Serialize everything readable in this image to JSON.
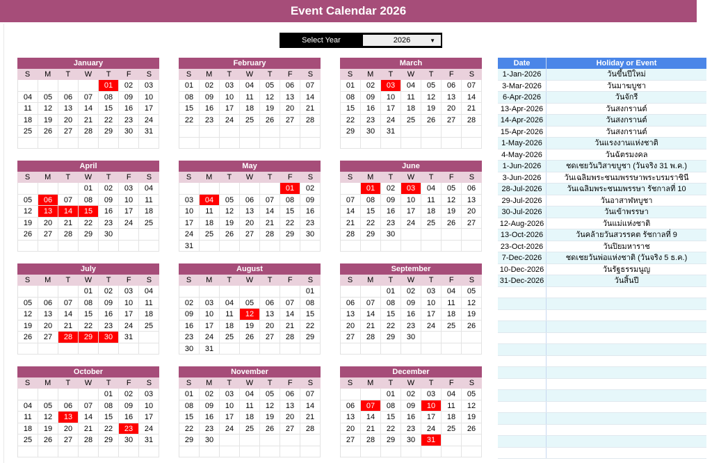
{
  "title": "Event Calendar 2026",
  "year_selector": {
    "label": "Select Year",
    "value": "2026"
  },
  "day_headers": [
    "S",
    "M",
    "T",
    "W",
    "T",
    "F",
    "S"
  ],
  "months": [
    {
      "name": "January",
      "start": 4,
      "days": 31,
      "holidays": [
        1
      ]
    },
    {
      "name": "February",
      "start": 0,
      "days": 28,
      "holidays": []
    },
    {
      "name": "March",
      "start": 0,
      "days": 31,
      "holidays": [
        3
      ]
    },
    {
      "name": "April",
      "start": 3,
      "days": 30,
      "holidays": [
        6,
        13,
        14,
        15
      ]
    },
    {
      "name": "May",
      "start": 5,
      "days": 31,
      "holidays": [
        1,
        4
      ]
    },
    {
      "name": "June",
      "start": 1,
      "days": 30,
      "holidays": [
        1,
        3
      ]
    },
    {
      "name": "July",
      "start": 3,
      "days": 31,
      "holidays": [
        28,
        29,
        30
      ]
    },
    {
      "name": "August",
      "start": 6,
      "days": 31,
      "holidays": [
        12
      ]
    },
    {
      "name": "September",
      "start": 2,
      "days": 30,
      "holidays": []
    },
    {
      "name": "October",
      "start": 4,
      "days": 31,
      "holidays": [
        13,
        23
      ]
    },
    {
      "name": "November",
      "start": 0,
      "days": 30,
      "holidays": []
    },
    {
      "name": "December",
      "start": 2,
      "days": 31,
      "holidays": [
        7,
        10,
        31
      ]
    }
  ],
  "events": {
    "headers": {
      "date": "Date",
      "event": "Holiday or Event"
    },
    "rows": [
      {
        "date": "1-Jan-2026",
        "event": "วันขึ้นปีใหม่"
      },
      {
        "date": "3-Mar-2026",
        "event": "วันมาฆบูชา"
      },
      {
        "date": "6-Apr-2026",
        "event": "วันจักรี"
      },
      {
        "date": "13-Apr-2026",
        "event": "วันสงกรานต์"
      },
      {
        "date": "14-Apr-2026",
        "event": "วันสงกรานต์"
      },
      {
        "date": "15-Apr-2026",
        "event": "วันสงกรานต์"
      },
      {
        "date": "1-May-2026",
        "event": "วันแรงงานแห่งชาติ"
      },
      {
        "date": "4-May-2026",
        "event": "วันฉัตรมงคล"
      },
      {
        "date": "1-Jun-2026",
        "event": "ชดเชยวันวิสาขบูชา (วันจริง 31 พ.ค.)"
      },
      {
        "date": "3-Jun-2026",
        "event": "วันเฉลิมพระชนมพรรษาพระบรมราชินี"
      },
      {
        "date": "28-Jul-2026",
        "event": "วันเฉลิมพระชนมพรรษา รัชกาลที่ 10"
      },
      {
        "date": "29-Jul-2026",
        "event": "วันอาสาฬหบูชา"
      },
      {
        "date": "30-Jul-2026",
        "event": "วันเข้าพรรษา"
      },
      {
        "date": "12-Aug-2026",
        "event": "วันแม่แห่งชาติ"
      },
      {
        "date": "13-Oct-2026",
        "event": "วันคล้ายวันสวรรคต รัชกาลที่ 9"
      },
      {
        "date": "23-Oct-2026",
        "event": "วันปิยมหาราช"
      },
      {
        "date": "7-Dec-2026",
        "event": "ชดเชยวันพ่อแห่งชาติ (วันจริง 5 ธ.ค.)"
      },
      {
        "date": "10-Dec-2026",
        "event": "วันรัฐธรรมนูญ"
      },
      {
        "date": "31-Dec-2026",
        "event": "วันสิ้นปี"
      },
      {
        "date": "",
        "event": ""
      },
      {
        "date": "",
        "event": ""
      },
      {
        "date": "",
        "event": ""
      },
      {
        "date": "",
        "event": ""
      },
      {
        "date": "",
        "event": ""
      },
      {
        "date": "",
        "event": ""
      },
      {
        "date": "",
        "event": ""
      },
      {
        "date": "",
        "event": ""
      },
      {
        "date": "",
        "event": ""
      },
      {
        "date": "",
        "event": ""
      },
      {
        "date": "",
        "event": ""
      },
      {
        "date": "",
        "event": ""
      },
      {
        "date": "",
        "event": ""
      },
      {
        "date": "",
        "event": ""
      },
      {
        "date": "",
        "event": ""
      }
    ]
  },
  "colors": {
    "accent": "#a64d79",
    "accent_light": "#ead1dc",
    "holiday": "#ff0000",
    "table_header": "#4a86e8",
    "table_stripe": "#e6f7fa"
  }
}
